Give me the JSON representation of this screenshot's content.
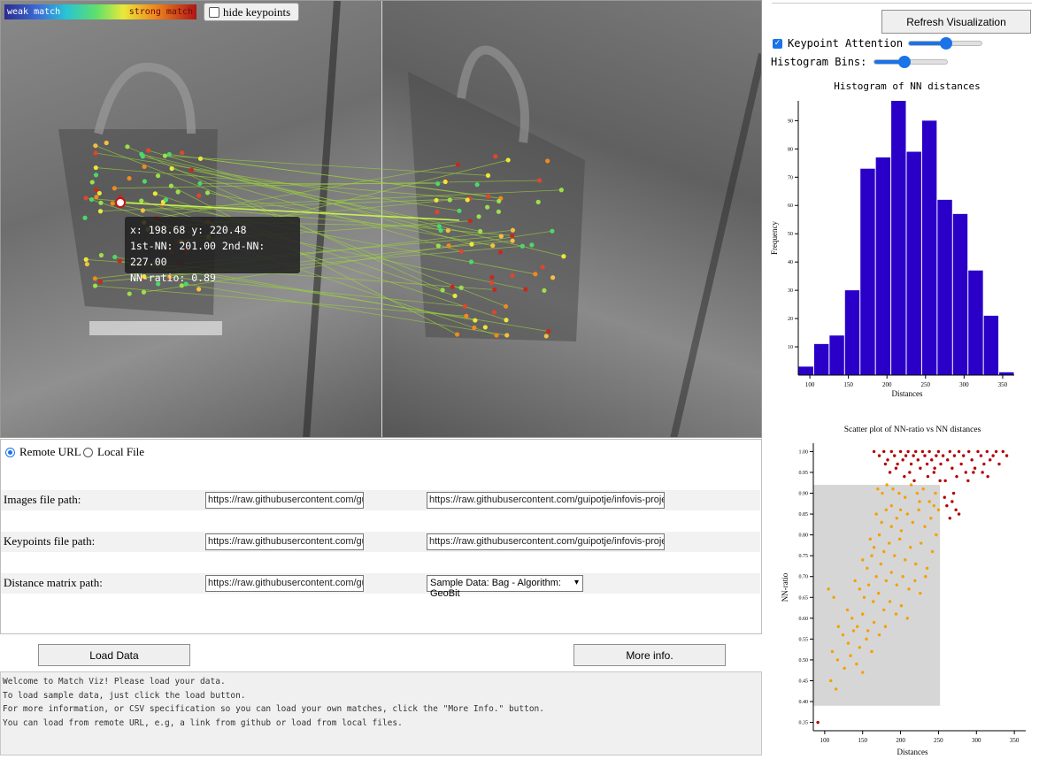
{
  "viewer": {
    "colorbar": {
      "weak_label": "weak match",
      "strong_label": "strong match"
    },
    "hide_keypoints_label": "hide keypoints",
    "tooltip": {
      "line1": "x: 198.68  y: 220.48",
      "line2": "1st-NN: 201.00  2nd-NN: 227.00",
      "line3": "NN-ratio: 0.89"
    }
  },
  "controls": {
    "refresh_label": "Refresh Visualization",
    "keypoint_attention_label": "Keypoint Attention",
    "keypoint_attention_checked": true,
    "keypoint_attention_level": 0.5,
    "histogram_bins_label": "Histogram Bins:",
    "histogram_bins_level": 0.4
  },
  "form": {
    "source_options": [
      {
        "label": "Remote URL",
        "selected": true
      },
      {
        "label": "Local File",
        "selected": false
      }
    ],
    "rows": [
      {
        "label": "Images file path:",
        "value1": "https://raw.githubusercontent.com/guipotje/in",
        "value2": "https://raw.githubusercontent.com/guipotje/infovis-project/main/samp"
      },
      {
        "label": "Keypoints file path:",
        "value1": "https://raw.githubusercontent.com/guipotje/in",
        "value2": "https://raw.githubusercontent.com/guipotje/infovis-project/main/samp"
      },
      {
        "label": "Distance matrix path:",
        "value1": "https://raw.githubusercontent.com/guipotje/in",
        "value2": "Sample Data: Bag - Algorithm: GeoBit"
      }
    ],
    "load_label": "Load Data",
    "more_info_label": "More info."
  },
  "log": {
    "lines": [
      "Welcome to Match Viz! Please load your data.",
      "To load sample data, just click the load button.",
      "For more information, or CSV specification so you can load your own matches, click the \"More Info.\" button.",
      "You can load from remote URL, e.g, a link from github or load from local files."
    ]
  },
  "chart_data": [
    {
      "type": "bar",
      "title": "Histogram of NN distances",
      "xlabel": "Distances",
      "ylabel": "Frequency",
      "bin_start": 85,
      "bin_width": 20,
      "values": [
        3,
        11,
        14,
        30,
        73,
        77,
        97,
        79,
        90,
        62,
        57,
        37,
        21,
        1
      ],
      "xticks": [
        100,
        150,
        200,
        250,
        300,
        350
      ],
      "yticks": [
        10,
        20,
        30,
        40,
        50,
        60,
        70,
        80,
        90
      ],
      "ylim": [
        0,
        97
      ],
      "xlim": [
        85,
        365
      ],
      "color": "#2a00c8"
    },
    {
      "type": "scatter",
      "title": "Scatter plot of NN-ratio vs NN distances",
      "xlabel": "Distances",
      "ylabel": "NN-ratio",
      "xticks": [
        100,
        150,
        200,
        250,
        300,
        350
      ],
      "yticks": [
        0.35,
        0.4,
        0.45,
        0.5,
        0.55,
        0.6,
        0.65,
        0.7,
        0.75,
        0.8,
        0.85,
        0.9,
        0.95,
        1.0
      ],
      "xlim": [
        85,
        365
      ],
      "ylim": [
        0.33,
        1.02
      ],
      "selection": {
        "x": [
          85,
          252
        ],
        "y": [
          0.39,
          0.92
        ]
      },
      "colors": {
        "strong": "#b30000",
        "weak": "#f5a000",
        "selection": "#d6d6d6"
      },
      "points_strong": [
        [
          165,
          1.0
        ],
        [
          172,
          0.99
        ],
        [
          178,
          1.0
        ],
        [
          183,
          0.98
        ],
        [
          188,
          1.0
        ],
        [
          192,
          0.99
        ],
        [
          196,
          0.97
        ],
        [
          200,
          1.0
        ],
        [
          203,
          0.98
        ],
        [
          207,
          0.99
        ],
        [
          210,
          1.0
        ],
        [
          214,
          0.97
        ],
        [
          217,
          0.99
        ],
        [
          220,
          1.0
        ],
        [
          223,
          0.98
        ],
        [
          226,
          0.96
        ],
        [
          229,
          1.0
        ],
        [
          232,
          0.99
        ],
        [
          235,
          0.97
        ],
        [
          238,
          1.0
        ],
        [
          241,
          0.98
        ],
        [
          244,
          0.95
        ],
        [
          247,
          0.99
        ],
        [
          250,
          1.0
        ],
        [
          253,
          0.97
        ],
        [
          256,
          0.99
        ],
        [
          259,
          0.93
        ],
        [
          262,
          0.98
        ],
        [
          265,
          1.0
        ],
        [
          268,
          0.96
        ],
        [
          271,
          0.99
        ],
        [
          274,
          0.94
        ],
        [
          277,
          1.0
        ],
        [
          280,
          0.97
        ],
        [
          283,
          0.99
        ],
        [
          286,
          0.95
        ],
        [
          290,
          1.0
        ],
        [
          294,
          0.98
        ],
        [
          298,
          0.96
        ],
        [
          302,
          1.0
        ],
        [
          306,
          0.99
        ],
        [
          310,
          0.97
        ],
        [
          314,
          1.0
        ],
        [
          318,
          0.98
        ],
        [
          322,
          0.99
        ],
        [
          326,
          1.0
        ],
        [
          330,
          0.97
        ],
        [
          335,
          1.0
        ],
        [
          340,
          0.99
        ],
        [
          261,
          0.87
        ],
        [
          268,
          0.88
        ],
        [
          273,
          0.86
        ],
        [
          277,
          0.85
        ],
        [
          265,
          0.84
        ],
        [
          258,
          0.89
        ],
        [
          270,
          0.9
        ],
        [
          180,
          0.97
        ],
        [
          186,
          0.95
        ],
        [
          194,
          0.96
        ],
        [
          205,
          0.94
        ],
        [
          212,
          0.95
        ],
        [
          218,
          0.93
        ],
        [
          236,
          0.94
        ],
        [
          245,
          0.96
        ],
        [
          252,
          0.93
        ],
        [
          289,
          0.93
        ],
        [
          296,
          0.95
        ],
        [
          308,
          0.95
        ],
        [
          315,
          0.94
        ]
      ],
      "points_weak": [
        [
          170,
          0.91
        ],
        [
          176,
          0.9
        ],
        [
          182,
          0.92
        ],
        [
          190,
          0.91
        ],
        [
          198,
          0.9
        ],
        [
          206,
          0.89
        ],
        [
          214,
          0.92
        ],
        [
          222,
          0.9
        ],
        [
          230,
          0.91
        ],
        [
          238,
          0.88
        ],
        [
          246,
          0.9
        ],
        [
          250,
          0.86
        ],
        [
          168,
          0.85
        ],
        [
          175,
          0.83
        ],
        [
          181,
          0.86
        ],
        [
          188,
          0.82
        ],
        [
          195,
          0.84
        ],
        [
          201,
          0.81
        ],
        [
          209,
          0.85
        ],
        [
          216,
          0.83
        ],
        [
          224,
          0.86
        ],
        [
          232,
          0.82
        ],
        [
          240,
          0.84
        ],
        [
          247,
          0.8
        ],
        [
          160,
          0.79
        ],
        [
          165,
          0.77
        ],
        [
          172,
          0.8
        ],
        [
          178,
          0.76
        ],
        [
          185,
          0.78
        ],
        [
          192,
          0.75
        ],
        [
          199,
          0.79
        ],
        [
          206,
          0.74
        ],
        [
          213,
          0.77
        ],
        [
          220,
          0.73
        ],
        [
          227,
          0.78
        ],
        [
          235,
          0.72
        ],
        [
          242,
          0.76
        ],
        [
          150,
          0.74
        ],
        [
          156,
          0.72
        ],
        [
          162,
          0.75
        ],
        [
          168,
          0.7
        ],
        [
          174,
          0.73
        ],
        [
          181,
          0.69
        ],
        [
          188,
          0.71
        ],
        [
          195,
          0.68
        ],
        [
          203,
          0.7
        ],
        [
          211,
          0.67
        ],
        [
          219,
          0.69
        ],
        [
          226,
          0.66
        ],
        [
          233,
          0.7
        ],
        [
          140,
          0.69
        ],
        [
          146,
          0.67
        ],
        [
          152,
          0.65
        ],
        [
          158,
          0.68
        ],
        [
          164,
          0.64
        ],
        [
          171,
          0.66
        ],
        [
          178,
          0.62
        ],
        [
          186,
          0.64
        ],
        [
          194,
          0.61
        ],
        [
          201,
          0.63
        ],
        [
          209,
          0.6
        ],
        [
          130,
          0.62
        ],
        [
          136,
          0.6
        ],
        [
          143,
          0.58
        ],
        [
          150,
          0.61
        ],
        [
          157,
          0.57
        ],
        [
          165,
          0.59
        ],
        [
          172,
          0.56
        ],
        [
          180,
          0.58
        ],
        [
          118,
          0.58
        ],
        [
          124,
          0.56
        ],
        [
          131,
          0.54
        ],
        [
          138,
          0.57
        ],
        [
          146,
          0.53
        ],
        [
          155,
          0.55
        ],
        [
          162,
          0.52
        ],
        [
          110,
          0.52
        ],
        [
          117,
          0.5
        ],
        [
          126,
          0.48
        ],
        [
          134,
          0.51
        ],
        [
          142,
          0.49
        ],
        [
          150,
          0.47
        ],
        [
          108,
          0.45
        ],
        [
          115,
          0.43
        ],
        [
          105,
          0.67
        ],
        [
          112,
          0.65
        ],
        [
          200,
          0.86
        ],
        [
          225,
          0.88
        ],
        [
          244,
          0.87
        ],
        [
          188,
          0.87
        ]
      ],
      "points_outlier": [
        [
          91,
          0.35
        ]
      ]
    }
  ]
}
